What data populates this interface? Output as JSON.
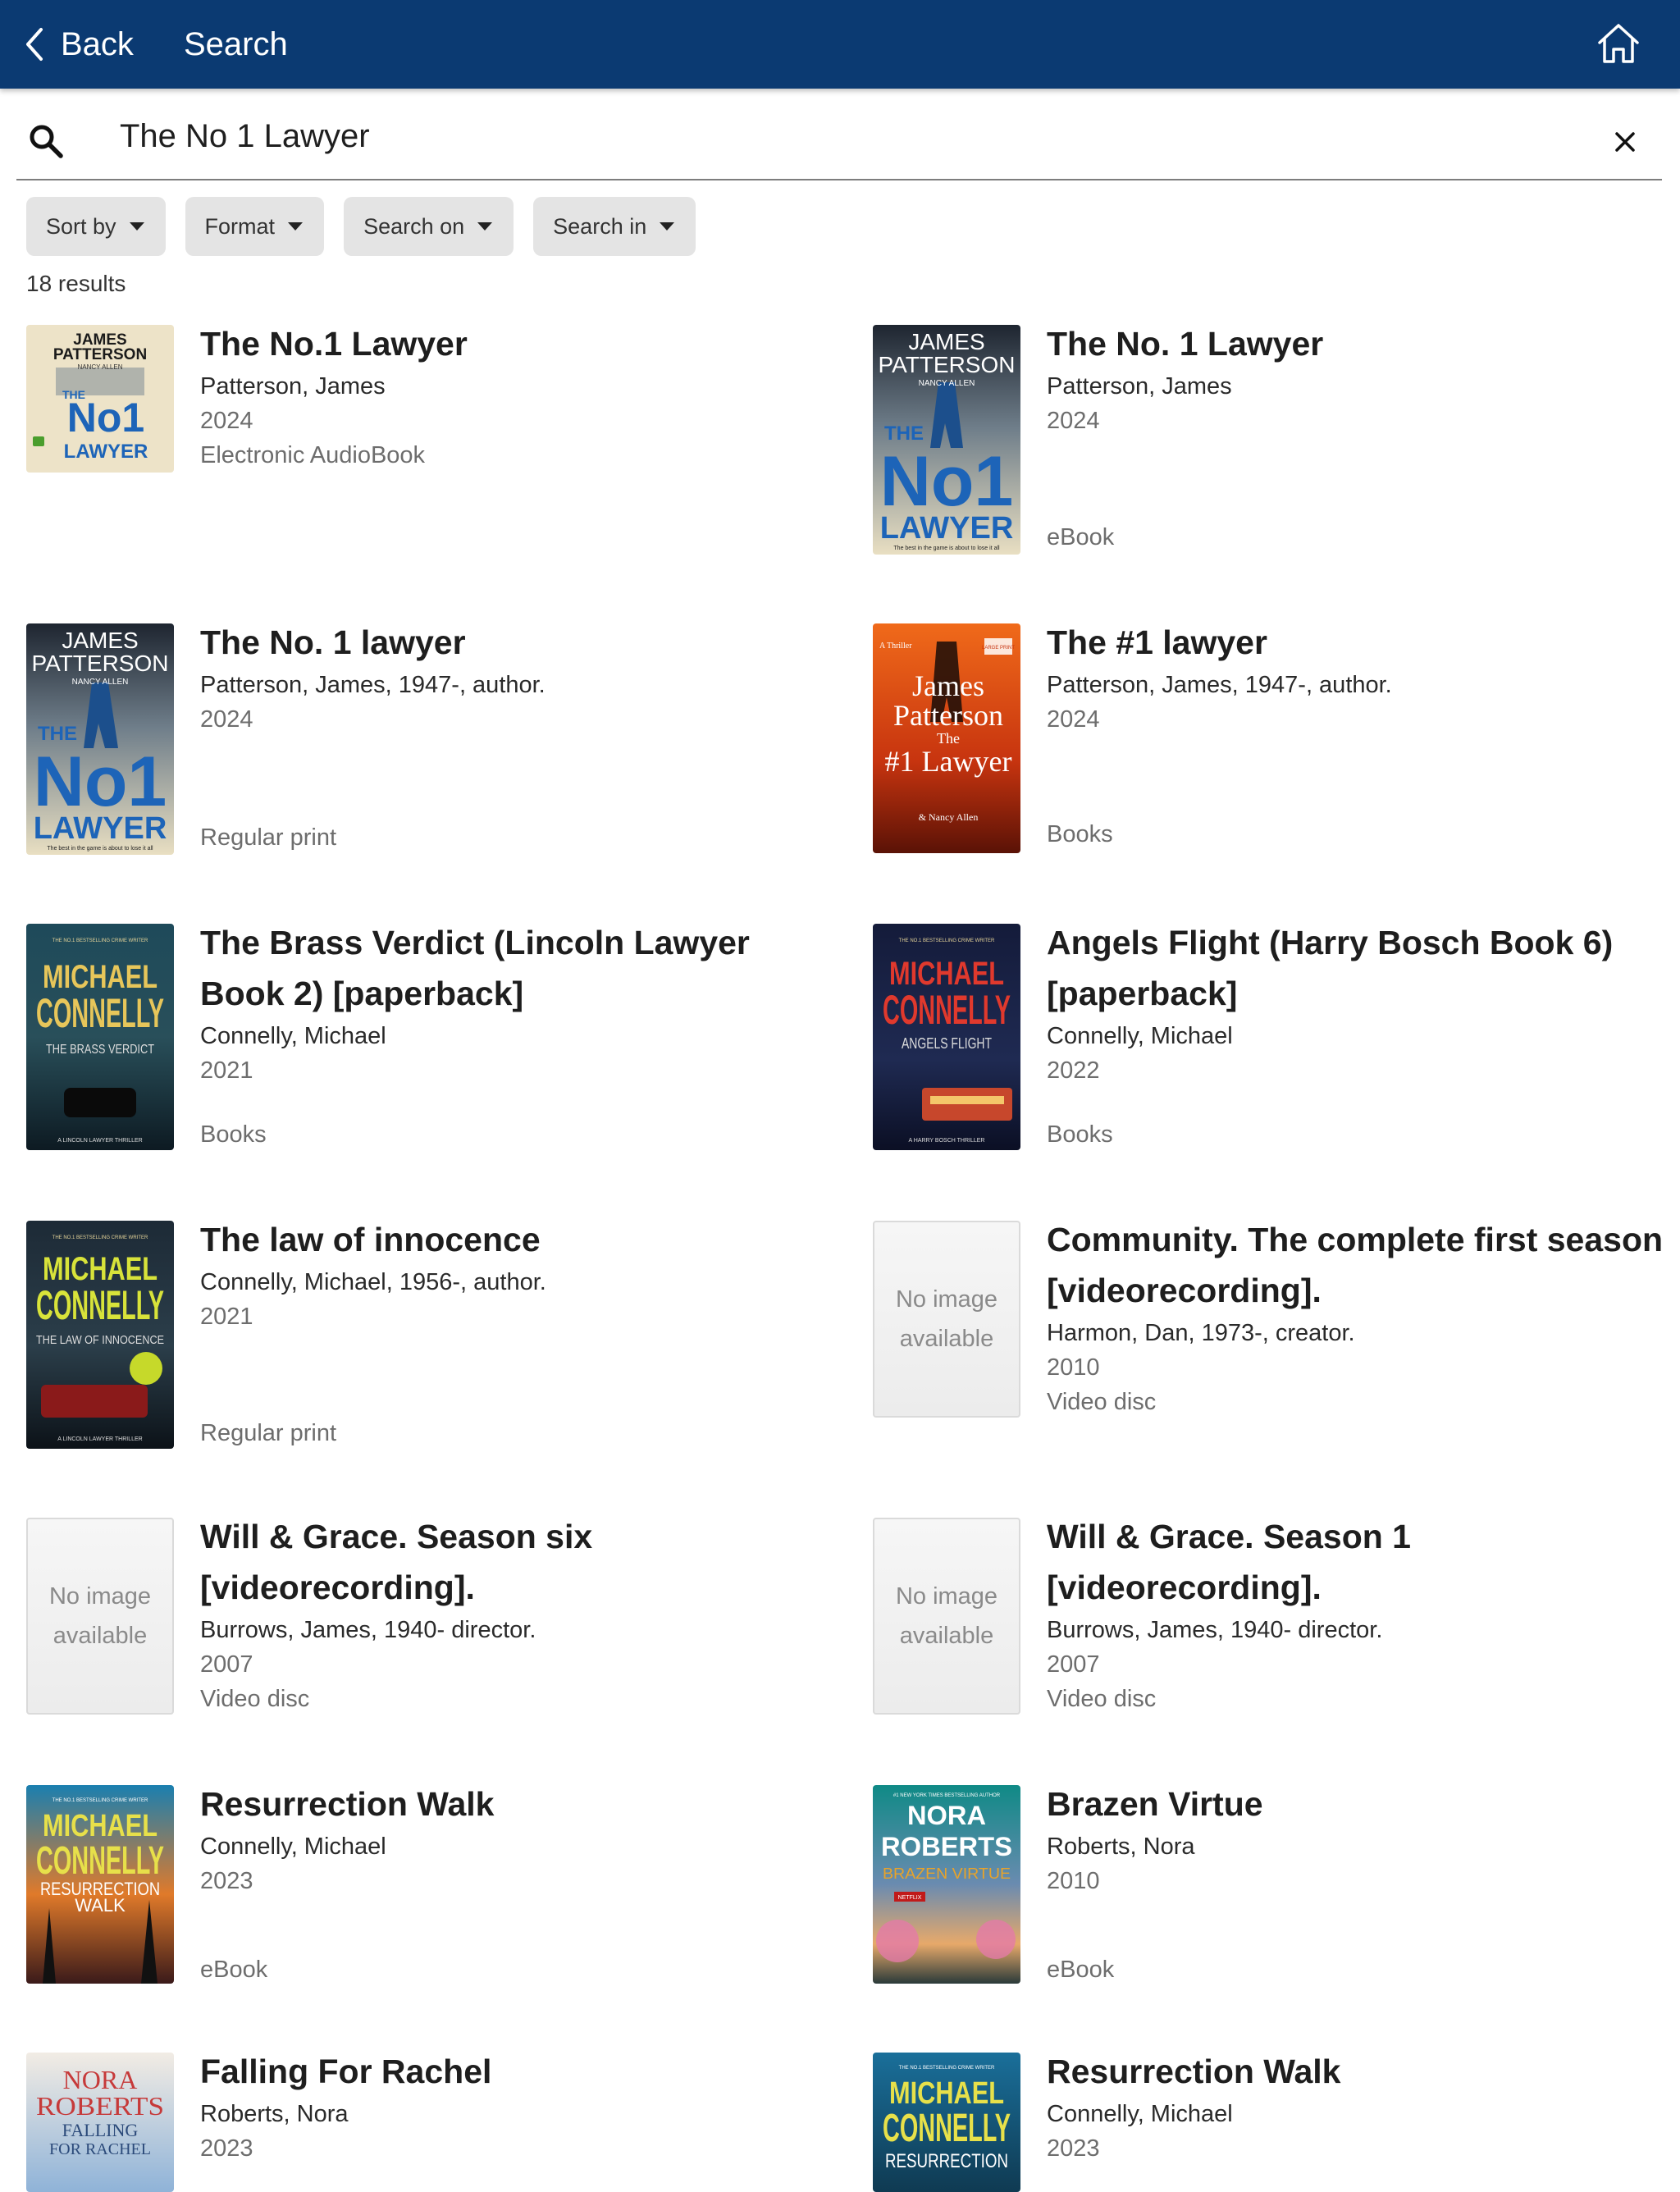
{
  "header": {
    "back_label": "Back",
    "title": "Search"
  },
  "search": {
    "query": "The No 1 Lawyer"
  },
  "filters": [
    "Sort by",
    "Format",
    "Search on",
    "Search in"
  ],
  "result_count": "18 results",
  "no_image_text": "No image available",
  "results": [
    {
      "title": "The No.1 Lawyer",
      "author": "Patterson, James",
      "year": "2024",
      "format": "Electronic AudioBook"
    },
    {
      "title": "The No. 1 Lawyer",
      "author": "Patterson, James",
      "year": "2024",
      "format": "eBook"
    },
    {
      "title": "The No. 1 lawyer",
      "author": "Patterson, James, 1947-, author.",
      "year": "2024",
      "format": "Regular print"
    },
    {
      "title": "The #1 lawyer",
      "author": "Patterson, James, 1947-, author.",
      "year": "2024",
      "format": "Books"
    },
    {
      "title": "The Brass Verdict (Lincoln Lawyer Book 2) [paperback]",
      "author": "Connelly, Michael",
      "year": "2021",
      "format": "Books"
    },
    {
      "title": "Angels Flight (Harry Bosch Book 6) [paperback]",
      "author": "Connelly, Michael",
      "year": "2022",
      "format": "Books"
    },
    {
      "title": "The law of innocence",
      "author": "Connelly, Michael, 1956-, author.",
      "year": "2021",
      "format": "Regular print"
    },
    {
      "title": "Community. The complete first season [videorecording].",
      "author": "Harmon, Dan, 1973-, creator.",
      "year": "2010",
      "format": "Video disc"
    },
    {
      "title": "Will & Grace. Season six [videorecording].",
      "author": "Burrows, James, 1940- director.",
      "year": "2007",
      "format": "Video disc"
    },
    {
      "title": "Will & Grace. Season 1 [videorecording].",
      "author": "Burrows, James, 1940- director.",
      "year": "2007",
      "format": "Video disc"
    },
    {
      "title": "Resurrection Walk",
      "author": "Connelly, Michael",
      "year": "2023",
      "format": "eBook"
    },
    {
      "title": "Brazen Virtue",
      "author": "Roberts, Nora",
      "year": "2010",
      "format": "eBook"
    },
    {
      "title": "Falling For Rachel",
      "author": "Roberts, Nora",
      "year": "2023",
      "format": ""
    },
    {
      "title": "Resurrection Walk",
      "author": "Connelly, Michael",
      "year": "2023",
      "format": ""
    }
  ],
  "covers": {
    "c1": {
      "top": "JAMES",
      "top2": "PATTERSON",
      "sub": "NANCY ALLEN",
      "the": "THE",
      "big": "No1",
      "bottom": "LAWYER"
    },
    "c2": {
      "top": "JAMES",
      "top2": "PATTERSON",
      "sub": "NANCY ALLEN",
      "the": "THE",
      "big": "No1",
      "bottom": "LAWYER",
      "tagline": "The best in the game is about to lose it all"
    },
    "c3": {
      "top": "JAMES",
      "top2": "PATTERSON",
      "sub": "NANCY ALLEN",
      "the": "THE",
      "big": "No1",
      "bottom": "LAWYER",
      "tagline": "The best in the game is about to lose it all"
    },
    "c4": {
      "corner": "A Thriller",
      "badge": "LARGE PRINT",
      "line1": "James",
      "line2": "Patterson",
      "the": "The",
      "big": "#1 Lawyer",
      "co": "& Nancy Allen"
    },
    "c5": {
      "banner": "THE NO.1 BESTSELLING CRIME WRITER",
      "line1": "MICHAEL",
      "line2": "CONNELLY",
      "title": "THE BRASS VERDICT",
      "footer": "A LINCOLN LAWYER THRILLER"
    },
    "c6": {
      "banner": "THE NO.1 BESTSELLING CRIME WRITER",
      "line1": "MICHAEL",
      "line2": "CONNELLY",
      "title": "ANGELS FLIGHT",
      "footer": "A HARRY BOSCH THRILLER"
    },
    "c7": {
      "banner": "THE NO.1 BESTSELLING CRIME WRITER",
      "line1": "MICHAEL",
      "line2": "CONNELLY",
      "title": "THE LAW OF INNOCENCE",
      "footer": "A LINCOLN LAWYER THRILLER"
    },
    "c11": {
      "banner": "THE NO.1 BESTSELLING CRIME WRITER",
      "line1": "MICHAEL",
      "line2": "CONNELLY",
      "title": "RESURRECTION",
      "title2": "WALK"
    },
    "c12": {
      "banner": "#1 NEW YORK TIMES BESTSELLING AUTHOR",
      "line1": "NORA",
      "line2": "ROBERTS",
      "title": "BRAZEN VIRTUE",
      "badge": "NETFLIX"
    },
    "c13": {
      "line1": "NORA",
      "line2": "ROBERTS",
      "title": "FALLING",
      "title2": "FOR RACHEL"
    },
    "c14": {
      "banner": "THE NO.1 BESTSELLING CRIME WRITER",
      "line1": "MICHAEL",
      "line2": "CONNELLY",
      "title": "RESURRECTION"
    }
  }
}
